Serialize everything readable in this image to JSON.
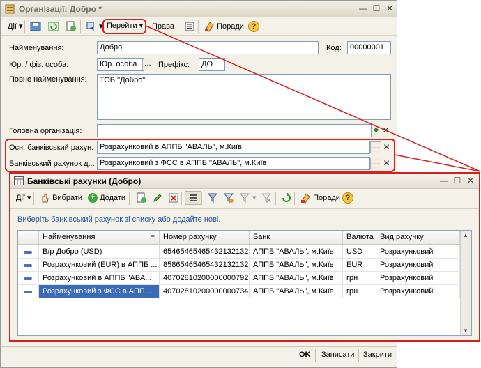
{
  "main_window": {
    "title": "Організації: Добро *",
    "toolbar": {
      "actions_label": "Дії",
      "goto_label": "Перейти",
      "rights_label": "Права",
      "tips_label": "Поради",
      "help_label": "?"
    },
    "form": {
      "name_label": "Найменування:",
      "name_value": "Добро",
      "code_label": "Код:",
      "code_value": "00000001",
      "type_label": "Юр. / фіз. особа:",
      "type_value": "Юр. особа",
      "prefix_label": "Префікс:",
      "prefix_value": "ДО",
      "fullname_label": "Повне найменування:",
      "fullname_value": "ТОВ \"Добро\"",
      "head_org_label": "Головна організація:",
      "head_org_value": "",
      "main_account_label": "Осн. банківський рахун...",
      "main_account_value": "Розрахунковий в АППБ \"АВАЛЬ\", м.Київ",
      "bank_account_label": "Банківський рахунок д...",
      "bank_account_value": "Розрахунковий з ФСС в АППБ \"АВАЛЬ\", м.Київ"
    },
    "footer": {
      "ok_label": "OK",
      "save_label": "Записати",
      "close_label": "Закрити"
    }
  },
  "sub_window": {
    "title": "Банківські рахунки (Добро)",
    "toolbar": {
      "actions_label": "Дії",
      "select_label": "Вибрати",
      "add_label": "Додати",
      "tips_label": "Поради",
      "help_label": "?"
    },
    "hint": "Виберіть банківський рахунок зі списку або додайте нові.",
    "columns": [
      "Найменування",
      "Номер рахунку",
      "Банк",
      "Валюта",
      "Вид рахунку"
    ],
    "rows": [
      [
        "В/р Добро (USD)",
        "6546546546543213213​2",
        "АППБ \"АВАЛЬ\", м.Київ",
        "USD",
        "Розрахунковий"
      ],
      [
        "Розрахунковий (EUR) в АППБ ...",
        "85865465465432132132",
        "АППБ \"АВАЛЬ\", м.Київ",
        "EUR",
        "Розрахунковий"
      ],
      [
        "Розрахунковий в АППБ \"АВА...",
        "40702810200000000792",
        "АППБ \"АВАЛЬ\", м.Київ",
        "грн",
        "Розрахунковий"
      ],
      [
        "Розрахунковий з ФСС в АПП...",
        "40702810200000000734",
        "АППБ \"АВАЛЬ\", м.Київ",
        "грн",
        "Розрахунковий"
      ]
    ],
    "selected_row": 3
  },
  "colors": {
    "highlight": "#d62020",
    "selection": "#3a6bb8",
    "link_text": "#1f4fa3"
  }
}
